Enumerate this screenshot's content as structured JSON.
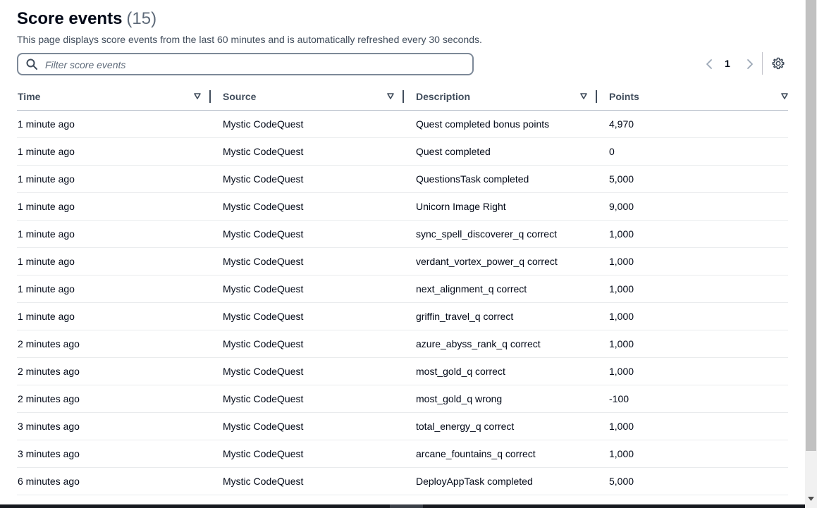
{
  "header": {
    "title": "Score events",
    "count": "(15)",
    "description": "This page displays score events from the last 60 minutes and is automatically refreshed every 30 seconds."
  },
  "filter": {
    "placeholder": "Filter score events",
    "value": "",
    "icon": "search-icon"
  },
  "pagination": {
    "current_page": "1",
    "prev_icon": "chevron-left-icon",
    "next_icon": "chevron-right-icon",
    "settings_icon": "gear-icon"
  },
  "table": {
    "columns": [
      "Time",
      "Source",
      "Description",
      "Points"
    ],
    "rows": [
      [
        "1 minute ago",
        "Mystic CodeQuest",
        "Quest completed bonus points",
        "4,970"
      ],
      [
        "1 minute ago",
        "Mystic CodeQuest",
        "Quest completed",
        "0"
      ],
      [
        "1 minute ago",
        "Mystic CodeQuest",
        "QuestionsTask completed",
        "5,000"
      ],
      [
        "1 minute ago",
        "Mystic CodeQuest",
        "Unicorn Image Right",
        "9,000"
      ],
      [
        "1 minute ago",
        "Mystic CodeQuest",
        "sync_spell_discoverer_q correct",
        "1,000"
      ],
      [
        "1 minute ago",
        "Mystic CodeQuest",
        "verdant_vortex_power_q correct",
        "1,000"
      ],
      [
        "1 minute ago",
        "Mystic CodeQuest",
        "next_alignment_q correct",
        "1,000"
      ],
      [
        "1 minute ago",
        "Mystic CodeQuest",
        "griffin_travel_q correct",
        "1,000"
      ],
      [
        "2 minutes ago",
        "Mystic CodeQuest",
        "azure_abyss_rank_q correct",
        "1,000"
      ],
      [
        "2 minutes ago",
        "Mystic CodeQuest",
        "most_gold_q correct",
        "1,000"
      ],
      [
        "2 minutes ago",
        "Mystic CodeQuest",
        "most_gold_q wrong",
        "-100"
      ],
      [
        "3 minutes ago",
        "Mystic CodeQuest",
        "total_energy_q correct",
        "1,000"
      ],
      [
        "3 minutes ago",
        "Mystic CodeQuest",
        "arcane_fountains_q correct",
        "1,000"
      ],
      [
        "6 minutes ago",
        "Mystic CodeQuest",
        "DeployAppTask completed",
        "5,000"
      ]
    ]
  },
  "colors": {
    "text": "#000716",
    "secondary_text": "#5f6b7a",
    "header_text": "#414d5c",
    "input_border": "#7d8998",
    "row_divider": "#e9ebed"
  }
}
